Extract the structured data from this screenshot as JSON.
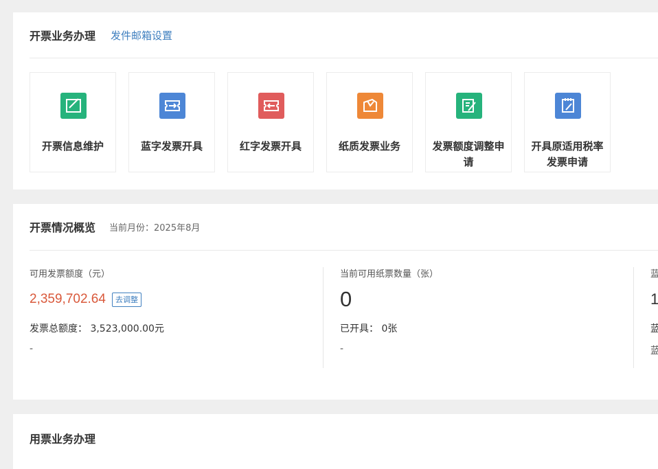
{
  "invoice_section": {
    "title": "开票业务办理",
    "link": "发件邮箱设置",
    "tiles": [
      {
        "label": "开票信息维护",
        "color": "#26b37c",
        "icon": "edit-check-icon"
      },
      {
        "label": "蓝字发票开具",
        "color": "#4d86d6",
        "icon": "ticket-arrow-right-icon"
      },
      {
        "label": "红字发票开具",
        "color": "#e05c5c",
        "icon": "ticket-arrow-left-icon"
      },
      {
        "label": "纸质发票业务",
        "color": "#ee8838",
        "icon": "paper-invoice-icon"
      },
      {
        "label": "发票额度调整申请",
        "color": "#26b37c",
        "icon": "quota-adjust-icon"
      },
      {
        "label": "开具原适用税率发票申请",
        "color": "#4d86d6",
        "icon": "clipboard-edit-icon"
      }
    ]
  },
  "overview_section": {
    "title": "开票情况概览",
    "month": "当前月份：2025年8月",
    "metrics": [
      {
        "label": "可用发票额度（元）",
        "value": "2,359,702.64",
        "button": "去调整",
        "sub": "发票总额度： 3,523,000.00元",
        "dash": "-"
      },
      {
        "label": "当前可用纸票数量（张）",
        "value": "0",
        "sub": "已开具： 0张",
        "dash": "-"
      },
      {
        "label": "蓝",
        "value": "1",
        "sub": "蓝",
        "dash": "蓝"
      }
    ]
  },
  "usage_section": {
    "title": "用票业务办理"
  }
}
